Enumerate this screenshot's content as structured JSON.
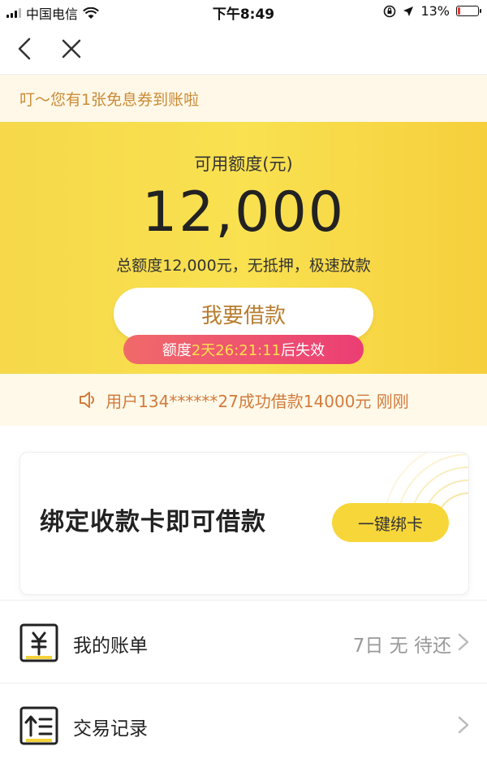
{
  "status_bar": {
    "carrier": "中国电信",
    "time": "下午8:49",
    "battery": "13%",
    "battery_level": 0.13
  },
  "nav": {
    "back_icon": "chevron-left-icon",
    "close_icon": "close-icon"
  },
  "notice": {
    "text": "叮～您有1张免息券到账啦"
  },
  "hero": {
    "label": "可用额度(元)",
    "amount": "12,000",
    "subtitle": "总额度12,000元，无抵押，极速放款",
    "borrow_button": "我要借款",
    "expire_prefix": "额度",
    "expire_time": "2天26:21:11",
    "expire_suffix": "后失效"
  },
  "ticker": {
    "icon": "speaker-icon",
    "text": "用户134******27成功借款14000元 刚刚"
  },
  "bind_card": {
    "title": "绑定收款卡即可借款",
    "button": "一键绑卡"
  },
  "menu": {
    "bill": {
      "label": "我的账单",
      "value": "7日 无 待还",
      "icon": "yuan-bill-icon"
    },
    "records": {
      "label": "交易记录",
      "icon": "records-list-icon"
    }
  },
  "colors": {
    "hero_yellow": "#f8dc48",
    "button_text": "#b77d2f",
    "pill_pink": "#eb3e74",
    "notice_text": "#c98b36"
  }
}
